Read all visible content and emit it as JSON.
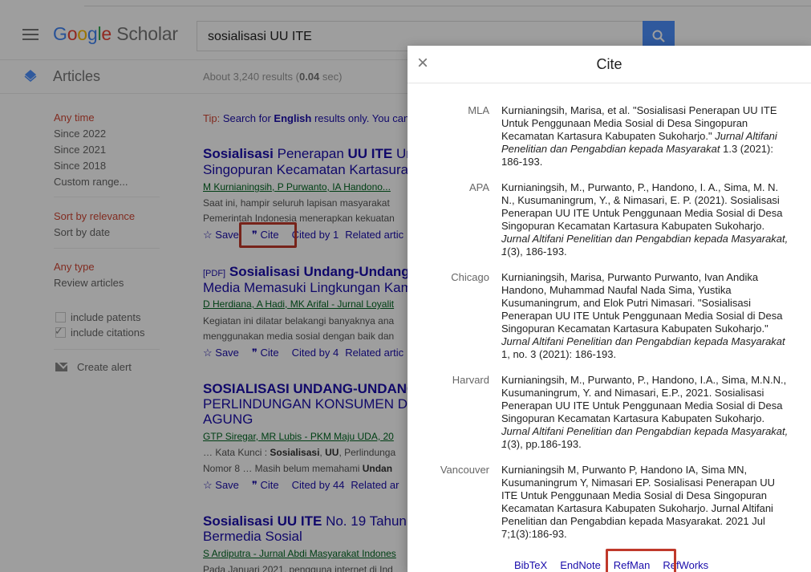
{
  "header": {
    "logo": {
      "g": "G",
      "o1": "o",
      "o2": "o",
      "g2": "g",
      "l": "l",
      "e": "e",
      "scholar": "Scholar"
    },
    "search_value": "sosialisasi UU ITE"
  },
  "subheader": {
    "section": "Articles",
    "results_prefix": "About 3,240 results (",
    "results_time": "0.04",
    "results_suffix": " sec)"
  },
  "sidebar": {
    "time": {
      "heading": "Any time",
      "items": [
        "Since 2022",
        "Since 2021",
        "Since 2018",
        "Custom range..."
      ]
    },
    "sort": {
      "selected": "Sort by relevance",
      "other": "Sort by date"
    },
    "type": {
      "selected": "Any type",
      "other": "Review articles"
    },
    "include_patents": "include patents",
    "include_citations": "include citations",
    "create_alert": "Create alert"
  },
  "tip": {
    "label": "Tip:",
    "text1": " Search for ",
    "english": "English",
    "text2": " results only. You can"
  },
  "results": [
    {
      "title_b1": "Sosialisasi",
      "title_t1": " Penerapan ",
      "title_b2": "UU ITE",
      "title_t2": " Un",
      "title_line2": "Singopuran Kecamatan Kartasura",
      "authors": "M Kurnianingsih, P Purwanto, IA Handono...",
      "snip1": "Saat ini, hampir seluruh lapisan masyarakat",
      "snip2": "Pemerintah Indonesia menerapkan kekuatan",
      "save": "Save",
      "cite": "Cite",
      "cited": "Cited by 1",
      "related": "Related artic"
    },
    {
      "pdf": "[PDF]",
      "title_b1": "Sosialisasi Undang-Undang",
      "title_line2": "Media Memasuki Lingkungan Kam",
      "authors": "D Herdiana, A Hadi, MK Arifal - Jurnal Loyalit",
      "snip1": "Kegiatan ini dilatar belakangi banyaknya ana",
      "snip2": "menggunakan media sosial dengan baik dan",
      "save": "Save",
      "cite": "Cite",
      "cited": "Cited by 4",
      "related": "Related artic"
    },
    {
      "title_b1": "SOSIALISASI UNDANG-UNDANG",
      "title_line2": "PERLINDUNGAN KONSUMEN D",
      "title_line3": "AGUNG",
      "authors": "GTP Siregar, MR Lubis - PKM Maju UDA, 20",
      "snip1_a": "… Kata Kunci : ",
      "snip1_b": "Sosialisasi",
      "snip1_c": ", ",
      "snip1_d": "UU",
      "snip1_e": ", Perlindunga",
      "snip2_a": "Nomor 8 … Masih belum memahami ",
      "snip2_b": "Undan",
      "save": "Save",
      "cite": "Cite",
      "cited": "Cited by 44",
      "related": "Related ar"
    },
    {
      "title_b1": "Sosialisasi UU ITE",
      "title_t1": " No. 19 Tahun",
      "title_line2": "Bermedia Sosial",
      "authors": "S Ardiputra - Jurnal Abdi Masyarakat Indones",
      "snip1": "Pada Januari 2021, pengguna internet di Ind"
    }
  ],
  "dialog": {
    "title": "Cite",
    "close": "×",
    "citations": [
      {
        "style": "MLA",
        "parts": [
          "Kurnianingsih, Marisa, et al. \"Sosialisasi Penerapan UU ITE Untuk Penggunaan Media Sosial di Desa Singopuran Kecamatan Kartasura Kabupaten Sukoharjo.\" ",
          "Jurnal Altifani Penelitian dan Pengabdian kepada Masyarakat",
          " 1.3 (2021): 186-193."
        ]
      },
      {
        "style": "APA",
        "parts": [
          "Kurnianingsih, M., Purwanto, P., Handono, I. A., Sima, M. N. N., Kusumaningrum, Y., & Nimasari, E. P. (2021). Sosialisasi Penerapan UU ITE Untuk Penggunaan Media Sosial di Desa Singopuran Kecamatan Kartasura Kabupaten Sukoharjo. ",
          "Jurnal Altifani Penelitian dan Pengabdian kepada Masyarakat, 1",
          "(3), 186-193."
        ]
      },
      {
        "style": "Chicago",
        "parts": [
          "Kurnianingsih, Marisa, Purwanto Purwanto, Ivan Andika Handono, Muhammad Naufal Nada Sima, Yustika Kusumaningrum, and Elok Putri Nimasari. \"Sosialisasi Penerapan UU ITE Untuk Penggunaan Media Sosial di Desa Singopuran Kecamatan Kartasura Kabupaten Sukoharjo.\" ",
          "Jurnal Altifani Penelitian dan Pengabdian kepada Masyarakat",
          " 1, no. 3 (2021): 186-193."
        ]
      },
      {
        "style": "Harvard",
        "parts": [
          "Kurnianingsih, M., Purwanto, P., Handono, I.A., Sima, M.N.N., Kusumaningrum, Y. and Nimasari, E.P., 2021. Sosialisasi Penerapan UU ITE Untuk Penggunaan Media Sosial di Desa Singopuran Kecamatan Kartasura Kabupaten Sukoharjo. ",
          "Jurnal Altifani Penelitian dan Pengabdian kepada Masyarakat, 1",
          "(3), pp.186-193."
        ]
      },
      {
        "style": "Vancouver",
        "parts": [
          "Kurnianingsih M, Purwanto P, Handono IA, Sima MN, Kusumaningrum Y, Nimasari EP. Sosialisasi Penerapan UU ITE Untuk Penggunaan Media Sosial di Desa Singopuran Kecamatan Kartasura Kabupaten Sukoharjo. Jurnal Altifani Penelitian dan Pengabdian kepada Masyarakat. 2021 Jul 7;1(3):186-93.",
          "",
          ""
        ]
      }
    ],
    "exports": [
      "BibTeX",
      "EndNote",
      "RefMan",
      "RefWorks"
    ]
  },
  "colors": {
    "link": "#1a0dab",
    "accent_red": "#d14836",
    "highlight_box": "#c0392b",
    "search_blue": "#4d90fe"
  }
}
